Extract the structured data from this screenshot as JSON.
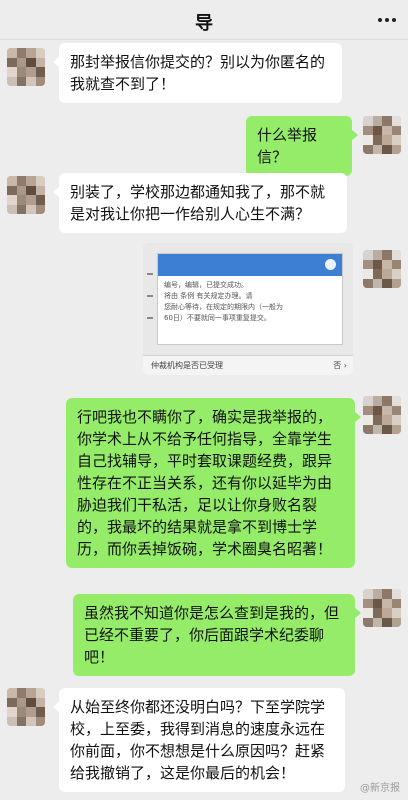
{
  "header": {
    "title": "导"
  },
  "colors": {
    "background": "#ededed",
    "incoming_bubble": "#ffffff",
    "outgoing_bubble": "#95ec69"
  },
  "icons": {
    "more": "ellipsis-icon"
  },
  "messages": [
    {
      "direction": "in",
      "type": "text",
      "text": "那封举报信你提交的？别以为你匿名的我就查不到了！"
    },
    {
      "direction": "out",
      "type": "text",
      "text": "什么举报信？"
    },
    {
      "direction": "in",
      "type": "text",
      "text": "别装了，学校那边都通知我了，那不就是对我让你把一作给别人心生不满？"
    },
    {
      "direction": "in",
      "type": "image",
      "image": {
        "dialog_lines": [
          "编号，编辑，已提交成功。",
          "将由 条例 有关规定办理。请",
          "您耐心等待，在规定的期限内（一般为",
          "60日）不要就同一事项重复提交。"
        ],
        "footer_left": "仲裁机构是否已受理",
        "footer_right": "否 ›"
      }
    },
    {
      "direction": "out",
      "type": "text",
      "text": "行吧我也不瞒你了，确实是我举报的，你学术上从不给予任何指导，全靠学生自己找辅导，平时套取课题经费，跟异性存在不正当关系，还有你以延毕为由胁迫我们干私活，足以让你身败名裂的，我最坏的结果就是拿不到博士学历，而你丢掉饭碗，学术圈臭名昭著！"
    },
    {
      "direction": "out",
      "type": "text",
      "text": "虽然我不知道你是怎么查到是我的，但已经不重要了，你后面跟学术纪委聊吧！"
    },
    {
      "direction": "in",
      "type": "text",
      "text": "从始至终你都还没明白吗？下至学院学校，上至委，我得到消息的速度永远在你前面，你不想想是什么原因吗？赶紧给我撤销了，这是你最后的机会！"
    }
  ],
  "watermark": "@新京报"
}
